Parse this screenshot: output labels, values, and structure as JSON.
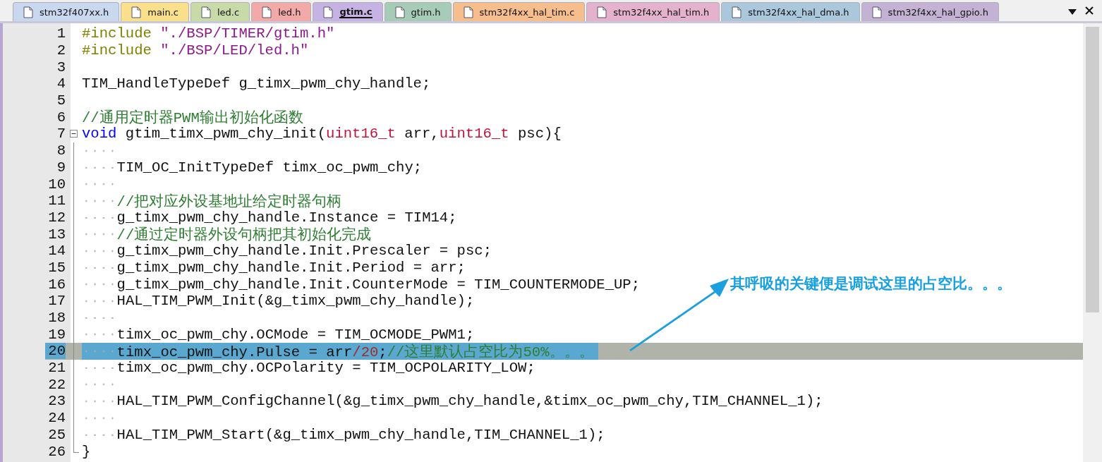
{
  "tabs": [
    {
      "label": "stm32f407xx.h",
      "color": "#c9d7ef",
      "selected": false
    },
    {
      "label": "main.c",
      "color": "#fbe08c",
      "selected": false
    },
    {
      "label": "led.c",
      "color": "#c9daa9",
      "selected": false
    },
    {
      "label": "led.h",
      "color": "#f1aaa7",
      "selected": false
    },
    {
      "label": "gtim.c",
      "color": "#c6b3e3",
      "selected": true
    },
    {
      "label": "gtim.h",
      "color": "#a6cbb7",
      "selected": false
    },
    {
      "label": "stm32f4xx_hal_tim.c",
      "color": "#f7be8d",
      "selected": false
    },
    {
      "label": "stm32f4xx_hal_tim.h",
      "color": "#e4b2cc",
      "selected": false
    },
    {
      "label": "stm32f4xx_hal_dma.h",
      "color": "#aac7dc",
      "selected": false
    },
    {
      "label": "stm32f4xx_hal_gpio.h",
      "color": "#c3b2d3",
      "selected": false
    }
  ],
  "lines": [
    {
      "number": "1",
      "indented": false,
      "selected": false,
      "fold_start": false,
      "fold_end": false,
      "code": [
        {
          "t": "#include ",
          "kind": "preproc"
        },
        {
          "t": "\"./BSP/TIMER/gtim.h\"",
          "kind": "string"
        }
      ]
    },
    {
      "number": "2",
      "indented": false,
      "selected": false,
      "fold_start": false,
      "fold_end": false,
      "code": [
        {
          "t": "#include ",
          "kind": "preproc"
        },
        {
          "t": "\"./BSP/LED/led.h\"",
          "kind": "string"
        }
      ]
    },
    {
      "number": "3",
      "indented": false,
      "selected": false,
      "fold_start": false,
      "fold_end": false
    },
    {
      "number": "4",
      "indented": false,
      "selected": false,
      "fold_start": false,
      "fold_end": false,
      "code": [
        {
          "t": "TIM_HandleTypeDef g_timx_pwm_chy_handle;",
          "kind": "plain"
        }
      ]
    },
    {
      "number": "5",
      "indented": false,
      "selected": false,
      "fold_start": false,
      "fold_end": false
    },
    {
      "number": "6",
      "indented": false,
      "selected": false,
      "fold_start": false,
      "fold_end": false,
      "code": [
        {
          "t": "//通用定时器PWM输出初始化函数",
          "kind": "comment"
        }
      ]
    },
    {
      "number": "7",
      "indented": false,
      "selected": false,
      "fold_start": true,
      "fold_end": false,
      "code": [
        {
          "t": "void",
          "kind": "keyword"
        },
        {
          "t": " gtim_timx_pwm_chy_init(",
          "kind": "plain"
        },
        {
          "t": "uint16_t",
          "kind": "type"
        },
        {
          "t": " arr,",
          "kind": "plain"
        },
        {
          "t": "uint16_t",
          "kind": "type"
        },
        {
          "t": " psc){",
          "kind": "plain"
        }
      ]
    },
    {
      "number": "8",
      "indented": true,
      "selected": false,
      "fold_start": false,
      "fold_end": false
    },
    {
      "number": "9",
      "indented": true,
      "selected": false,
      "fold_start": false,
      "fold_end": false,
      "code": [
        {
          "t": "TIM_OC_InitTypeDef timx_oc_pwm_chy;",
          "kind": "plain"
        }
      ]
    },
    {
      "number": "10",
      "indented": true,
      "selected": false,
      "fold_start": false,
      "fold_end": false
    },
    {
      "number": "11",
      "indented": true,
      "selected": false,
      "fold_start": false,
      "fold_end": false,
      "code": [
        {
          "t": "//把对应外设基地址给定时器句柄",
          "kind": "comment"
        }
      ]
    },
    {
      "number": "12",
      "indented": true,
      "selected": false,
      "fold_start": false,
      "fold_end": false,
      "code": [
        {
          "t": "g_timx_pwm_chy_handle.Instance = TIM14;",
          "kind": "plain"
        }
      ]
    },
    {
      "number": "13",
      "indented": true,
      "selected": false,
      "fold_start": false,
      "fold_end": false,
      "code": [
        {
          "t": "//通过定时器外设句柄把其初始化完成",
          "kind": "comment"
        }
      ]
    },
    {
      "number": "14",
      "indented": true,
      "selected": false,
      "fold_start": false,
      "fold_end": false,
      "code": [
        {
          "t": "g_timx_pwm_chy_handle.Init.Prescaler = psc;",
          "kind": "plain"
        }
      ]
    },
    {
      "number": "15",
      "indented": true,
      "selected": false,
      "fold_start": false,
      "fold_end": false,
      "code": [
        {
          "t": "g_timx_pwm_chy_handle.Init.Period = arr;",
          "kind": "plain"
        }
      ]
    },
    {
      "number": "16",
      "indented": true,
      "selected": false,
      "fold_start": false,
      "fold_end": false,
      "code": [
        {
          "t": "g_timx_pwm_chy_handle.Init.CounterMode = TIM_COUNTERMODE_UP;",
          "kind": "plain"
        }
      ]
    },
    {
      "number": "17",
      "indented": true,
      "selected": false,
      "fold_start": false,
      "fold_end": false,
      "code": [
        {
          "t": "HAL_TIM_PWM_Init(&g_timx_pwm_chy_handle);",
          "kind": "plain"
        }
      ]
    },
    {
      "number": "18",
      "indented": true,
      "selected": false,
      "fold_start": false,
      "fold_end": false
    },
    {
      "number": "19",
      "indented": true,
      "selected": false,
      "fold_start": false,
      "fold_end": false,
      "code": [
        {
          "t": "timx_oc_pwm_chy.OCMode = TIM_OCMODE_PWM1;",
          "kind": "plain"
        }
      ]
    },
    {
      "number": "20",
      "indented": true,
      "selected": true,
      "fold_start": false,
      "fold_end": false,
      "code": [
        {
          "t": "timx_oc_pwm_chy.Pulse = arr",
          "kind": "plain"
        },
        {
          "t": "/20",
          "kind": "number"
        },
        {
          "t": ";",
          "kind": "plain"
        },
        {
          "t": "//这里默认占空比为50%。。。",
          "kind": "comment"
        }
      ]
    },
    {
      "number": "21",
      "indented": true,
      "selected": false,
      "fold_start": false,
      "fold_end": false,
      "code": [
        {
          "t": "timx_oc_pwm_chy.OCPolarity = TIM_OCPOLARITY_LOW;",
          "kind": "plain"
        }
      ]
    },
    {
      "number": "22",
      "indented": true,
      "selected": false,
      "fold_start": false,
      "fold_end": false
    },
    {
      "number": "23",
      "indented": true,
      "selected": false,
      "fold_start": false,
      "fold_end": false,
      "code": [
        {
          "t": "HAL_TIM_PWM_ConfigChannel(&g_timx_pwm_chy_handle,&timx_oc_pwm_chy,TIM_CHANNEL_1);",
          "kind": "plain"
        }
      ]
    },
    {
      "number": "24",
      "indented": true,
      "selected": false,
      "fold_start": false,
      "fold_end": false
    },
    {
      "number": "25",
      "indented": true,
      "selected": false,
      "fold_start": false,
      "fold_end": false,
      "code": [
        {
          "t": "HAL_TIM_PWM_Start(&g_timx_pwm_chy_handle,TIM_CHANNEL_1);",
          "kind": "plain"
        }
      ]
    },
    {
      "number": "26",
      "indented": false,
      "selected": false,
      "fold_start": false,
      "fold_end": true,
      "code": [
        {
          "t": "}",
          "kind": "plain"
        }
      ]
    }
  ],
  "annotation": {
    "text": "其呼吸的关键便是调试这里的占空比。。。"
  }
}
